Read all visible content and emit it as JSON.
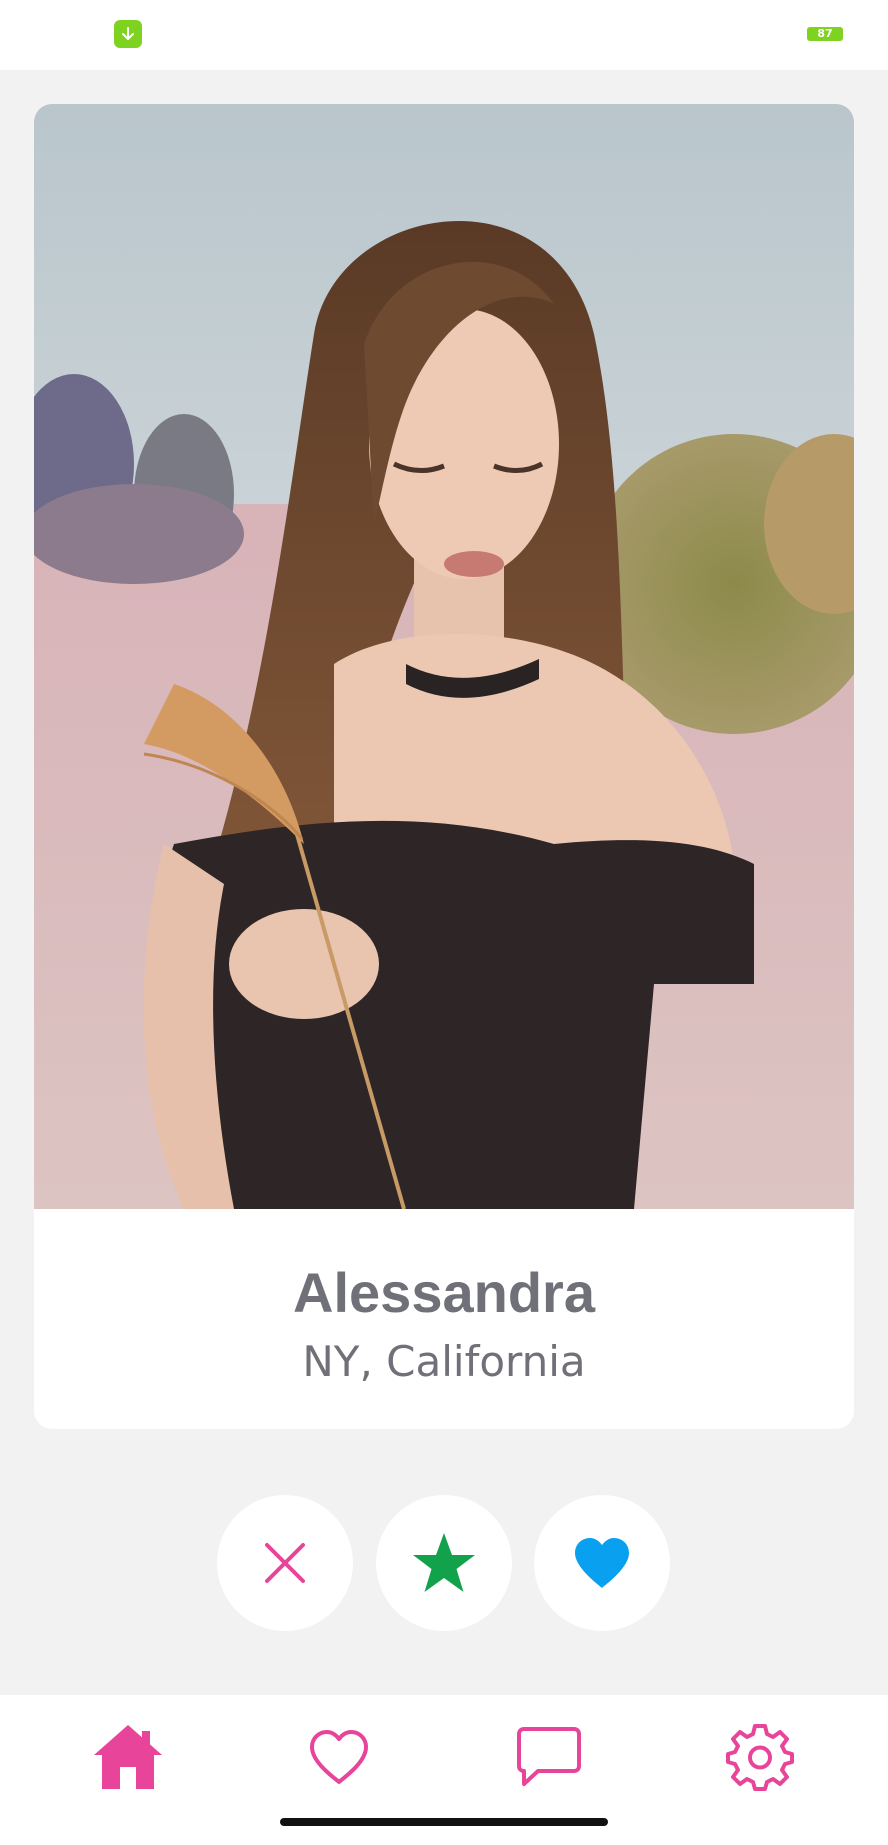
{
  "status_bar": {
    "download_icon": "download-arrow-icon",
    "battery_level": "87",
    "accent_color": "#7ed321"
  },
  "profile": {
    "name": "Alessandra",
    "location": "NY, California",
    "photo_icon": "profile-photo"
  },
  "actions": [
    {
      "name": "dislike",
      "icon": "close-icon",
      "color": "#e8459a"
    },
    {
      "name": "super-like",
      "icon": "star-icon",
      "color": "#12a24b"
    },
    {
      "name": "like",
      "icon": "heart-filled-icon",
      "color": "#0aa0f0"
    }
  ],
  "bottom_nav": {
    "items": [
      {
        "name": "home",
        "icon": "home-icon",
        "active": true
      },
      {
        "name": "likes",
        "icon": "heart-outline-icon",
        "active": false
      },
      {
        "name": "messages",
        "icon": "chat-bubble-icon",
        "active": false
      },
      {
        "name": "settings",
        "icon": "gear-icon",
        "active": false
      }
    ],
    "accent_color": "#e8459a"
  }
}
